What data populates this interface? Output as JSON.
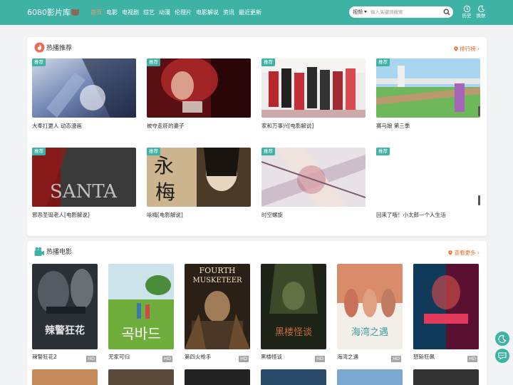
{
  "header": {
    "logo": "6080影片库",
    "nav": [
      {
        "label": "首页",
        "active": true
      },
      {
        "label": "电影",
        "active": false
      },
      {
        "label": "电视剧",
        "active": false
      },
      {
        "label": "综艺",
        "active": false
      },
      {
        "label": "动漫",
        "active": false
      },
      {
        "label": "伦理片",
        "active": false
      },
      {
        "label": "电影解说",
        "active": false
      },
      {
        "label": "资讯",
        "active": false
      },
      {
        "label": "最近更新",
        "active": false
      }
    ],
    "search": {
      "type": "视频",
      "placeholder": "输入关键词搜索"
    },
    "history_label": "历史",
    "theme_label": "换肤"
  },
  "hot_recommend": {
    "title": "热播推荐",
    "more": "排行榜",
    "badge": "推荐",
    "items": [
      {
        "title": "大奉打更人 动态漫画"
      },
      {
        "title": "被夺走肝的妻子"
      },
      {
        "title": "家和万事兴[电影解说]"
      },
      {
        "title": "赛马娘 第三季"
      },
      {
        "title": "邪恶圣诞老人[电影解说]"
      },
      {
        "title": "咏梅[电影解说]"
      },
      {
        "title": "时空螺旋"
      },
      {
        "title": "回来了哦！小太郎一个人生活"
      }
    ]
  },
  "hot_movies": {
    "title": "热播电影",
    "more": "查看更多",
    "hd": "HD",
    "items": [
      {
        "title": "辣警狂花2"
      },
      {
        "title": "无家可归"
      },
      {
        "title": "第四火枪手"
      },
      {
        "title": "黑楼怪谈"
      },
      {
        "title": "海湾之遇"
      },
      {
        "title": "怒斩狂飙"
      }
    ]
  },
  "colors": {
    "accent": "#3fb2a6",
    "highlight": "#ee6a2c"
  }
}
